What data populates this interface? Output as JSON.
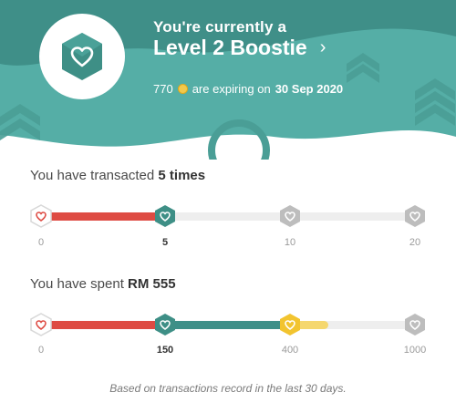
{
  "header": {
    "line1": "You're currently a",
    "level_title": "Level 2 Boostie",
    "chevron": "›",
    "points": "770",
    "expiring_text": "are expiring on",
    "expiry_date": "30 Sep 2020",
    "colors": {
      "teal": "#4fa7a0",
      "teal_dark": "#3d8f88",
      "badge": "#3e8f86"
    }
  },
  "transactions": {
    "prefix": "You have transacted",
    "value": "5 times",
    "progress_color": "#de4b43",
    "ticks": [
      {
        "label": "0",
        "active": false,
        "state": "start"
      },
      {
        "label": "5",
        "active": true,
        "state": "current"
      },
      {
        "label": "10",
        "active": false,
        "state": "locked"
      },
      {
        "label": "20",
        "active": false,
        "state": "locked"
      }
    ]
  },
  "spending": {
    "prefix": "You have spent",
    "value": "RM 555",
    "progress_colors": [
      "#de4b43",
      "#3d8f88",
      "#f5d76e"
    ],
    "ticks": [
      {
        "label": "0",
        "active": false,
        "state": "start"
      },
      {
        "label": "150",
        "active": true,
        "state": "current"
      },
      {
        "label": "400",
        "active": false,
        "state": "gold"
      },
      {
        "label": "1000",
        "active": false,
        "state": "locked"
      }
    ]
  },
  "footnote": "Based on transactions record in the last 30 days."
}
